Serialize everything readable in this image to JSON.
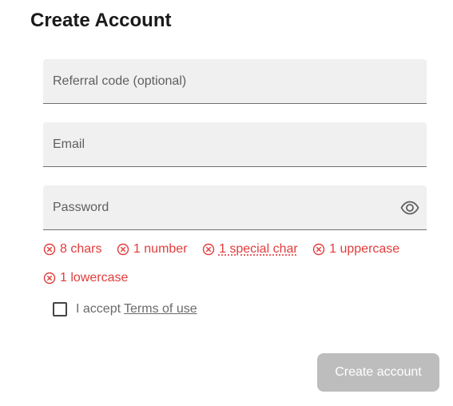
{
  "page": {
    "title": "Create Account"
  },
  "form": {
    "referral": {
      "placeholder": "Referral code (optional)",
      "value": ""
    },
    "email": {
      "placeholder": "Email",
      "value": ""
    },
    "password": {
      "placeholder": "Password",
      "value": "",
      "toggle_icon": "eye-icon"
    },
    "requirements": [
      {
        "label": "8 chars",
        "icon": "x-circle-icon"
      },
      {
        "label": "1 number",
        "icon": "x-circle-icon"
      },
      {
        "label": "1 special char",
        "icon": "x-circle-icon"
      },
      {
        "label": "1 uppercase",
        "icon": "x-circle-icon"
      },
      {
        "label": "1 lowercase",
        "icon": "x-circle-icon"
      }
    ],
    "terms": {
      "prefix": "I accept",
      "link_label": "Terms of use",
      "checked": false
    },
    "submit_label": "Create account"
  },
  "colors": {
    "error": "#e23c3c",
    "field_bg": "#f0f0f0",
    "button_disabled_bg": "#bdbdbd"
  }
}
